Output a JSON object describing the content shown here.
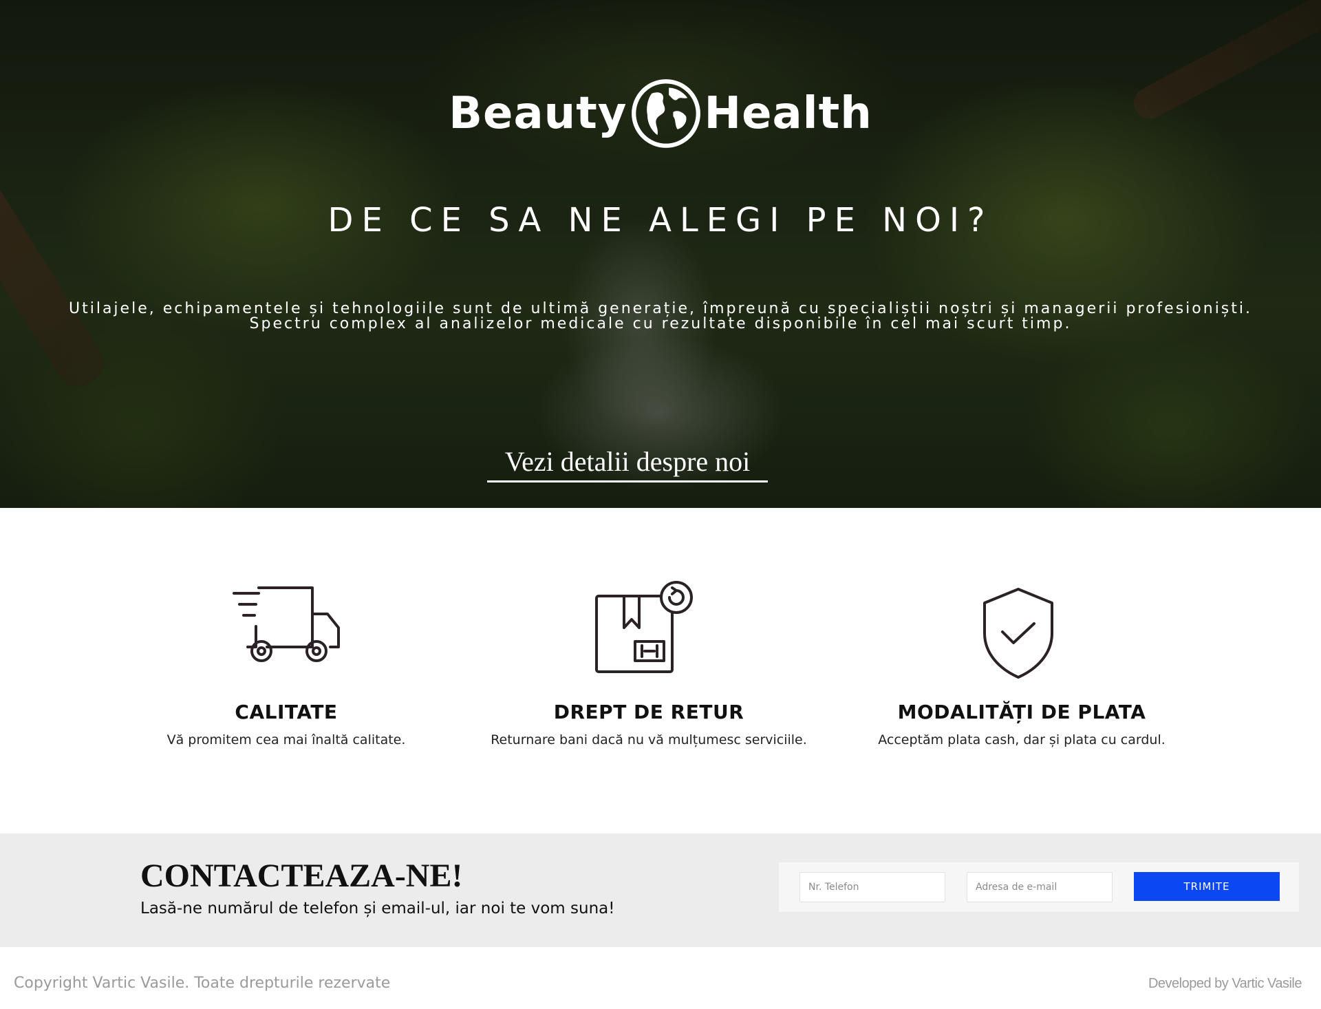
{
  "hero": {
    "logo_left": "Beauty",
    "logo_right": "Health",
    "title": "DE CE SA NE ALEGI PE NOI?",
    "text": "Utilajele, echipamentele și tehnologiile sunt de ultimă generație, împreună cu specialiștii noștri și managerii profesioniști. Spectru complex al analizelor medicale cu rezultate disponibile în cel mai scurt timp.",
    "link_label": "Vezi detalii despre noi"
  },
  "features": [
    {
      "icon": "delivery-truck-icon",
      "title": "CALITATE",
      "description": "Vă promitem cea mai înaltă calitate."
    },
    {
      "icon": "return-box-icon",
      "title": "DREPT DE RETUR",
      "description": "Returnare bani dacă nu vă mulțumesc serviciile."
    },
    {
      "icon": "shield-check-icon",
      "title": "MODALITĂȚI DE PLATA",
      "description": "Acceptăm plata cash, dar și plata cu cardul."
    }
  ],
  "contact": {
    "title": "CONTACTEAZA-NE!",
    "subtitle": "Lasă-ne numărul de telefon și email-ul, iar noi te vom suna!",
    "phone_placeholder": "Nr. Telefon",
    "email_placeholder": "Adresa de e-mail",
    "submit_label": "TRIMITE"
  },
  "footer": {
    "copyright": "Copyright Vartic Vasile. Toate drepturile rezervate",
    "developed": "Developed by Vartic Vasile"
  },
  "colors": {
    "accent": "#0b47f2",
    "contact_bg": "#ececec",
    "footer_text": "#9a9a9a"
  }
}
